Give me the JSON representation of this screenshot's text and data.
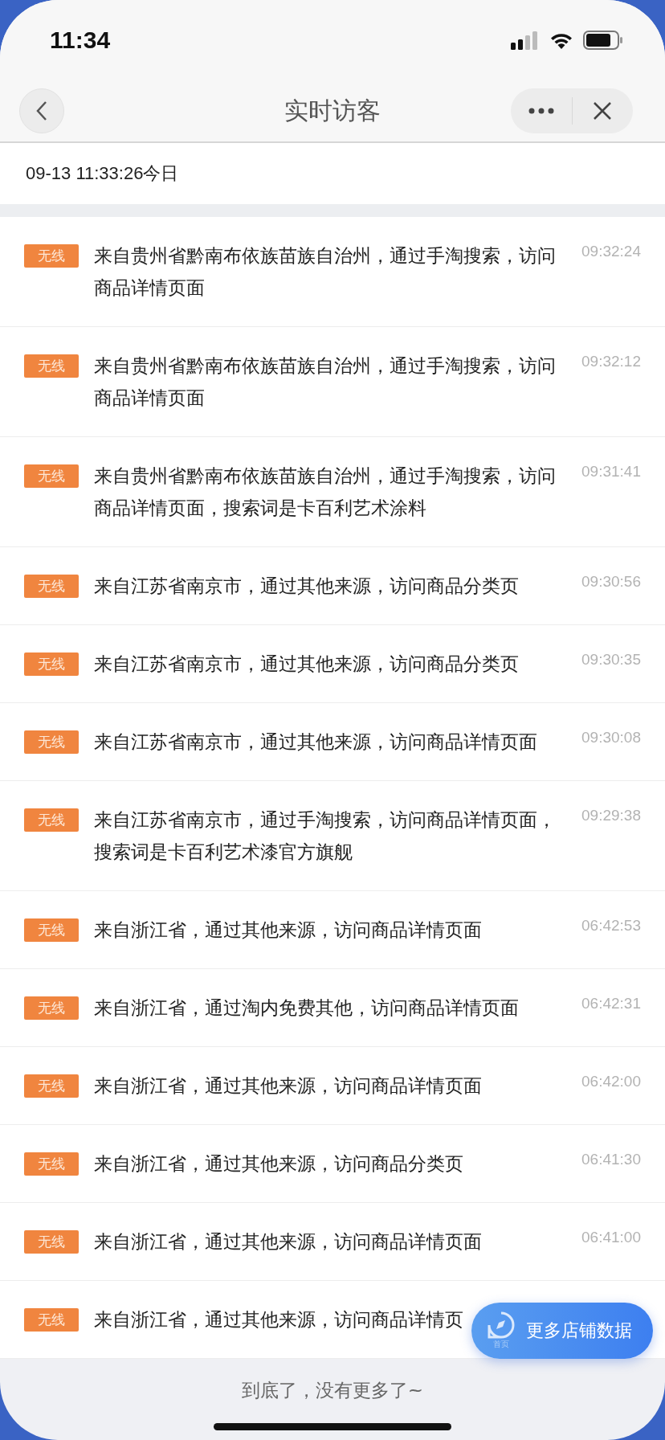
{
  "status_bar": {
    "time": "11:34"
  },
  "nav": {
    "title": "实时访客"
  },
  "date_header": "09-13 11:33:26今日",
  "visits": [
    {
      "badge": "无线",
      "text": "来自贵州省黔南布依族苗族自治州，通过手淘搜索，访问商品详情页面",
      "time": "09:32:24"
    },
    {
      "badge": "无线",
      "text": "来自贵州省黔南布依族苗族自治州，通过手淘搜索，访问商品详情页面",
      "time": "09:32:12"
    },
    {
      "badge": "无线",
      "text": "来自贵州省黔南布依族苗族自治州，通过手淘搜索，访问商品详情页面，搜索词是卡百利艺术涂料",
      "time": "09:31:41"
    },
    {
      "badge": "无线",
      "text": "来自江苏省南京市，通过其他来源，访问商品分类页",
      "time": "09:30:56"
    },
    {
      "badge": "无线",
      "text": "来自江苏省南京市，通过其他来源，访问商品分类页",
      "time": "09:30:35"
    },
    {
      "badge": "无线",
      "text": "来自江苏省南京市，通过其他来源，访问商品详情页面",
      "time": "09:30:08"
    },
    {
      "badge": "无线",
      "text": "来自江苏省南京市，通过手淘搜索，访问商品详情页面，搜索词是卡百利艺术漆官方旗舰",
      "time": "09:29:38"
    },
    {
      "badge": "无线",
      "text": "来自浙江省，通过其他来源，访问商品详情页面",
      "time": "06:42:53"
    },
    {
      "badge": "无线",
      "text": "来自浙江省，通过淘内免费其他，访问商品详情页面",
      "time": "06:42:31"
    },
    {
      "badge": "无线",
      "text": "来自浙江省，通过其他来源，访问商品详情页面",
      "time": "06:42:00"
    },
    {
      "badge": "无线",
      "text": "来自浙江省，通过其他来源，访问商品分类页",
      "time": "06:41:30"
    },
    {
      "badge": "无线",
      "text": "来自浙江省，通过其他来源，访问商品详情页面",
      "time": "06:41:00"
    },
    {
      "badge": "无线",
      "text": "来自浙江省，通过其他来源，访问商品详情页"
    }
  ],
  "footer": "到底了，没有更多了~",
  "floating_button": {
    "icon_label": "首页",
    "label": "更多店铺数据"
  }
}
